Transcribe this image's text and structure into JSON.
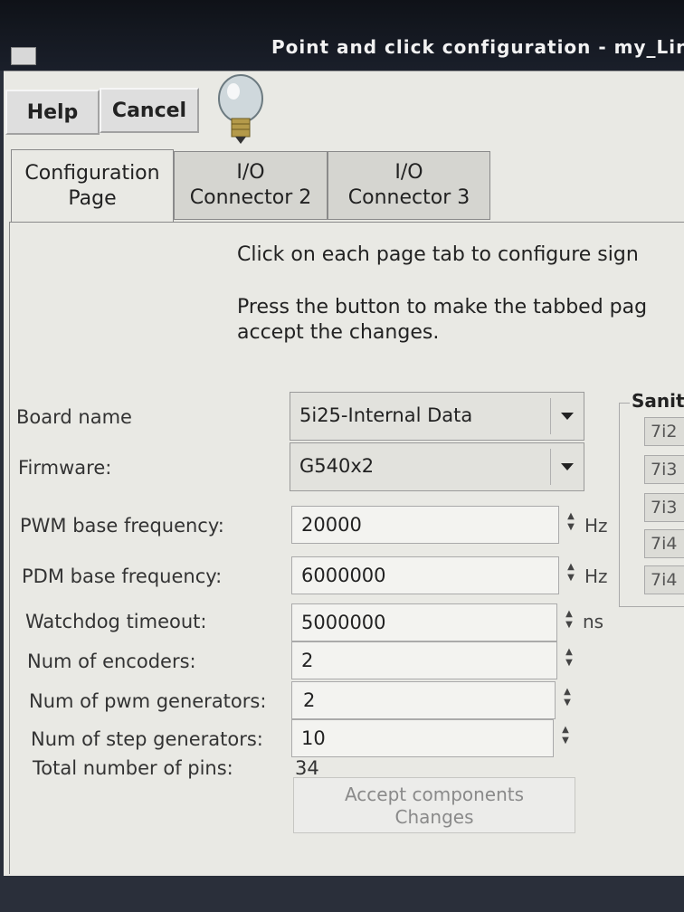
{
  "window": {
    "title": "Point and click configuration - my_Lin"
  },
  "toolbar": {
    "help_label": "Help",
    "cancel_label": "Cancel"
  },
  "tabs": [
    {
      "line1": "Configuration",
      "line2": "Page"
    },
    {
      "line1": "I/O",
      "line2": "Connector 2"
    },
    {
      "line1": "I/O",
      "line2": "Connector 3"
    }
  ],
  "instructions": {
    "line1": "Click on each page tab to configure sign",
    "line2": "Press the button to make the tabbed pag",
    "line3": "accept the changes."
  },
  "fields": {
    "board_name": {
      "label": "Board name",
      "value": "5i25-Internal Data"
    },
    "firmware": {
      "label": "Firmware:",
      "value": "G540x2"
    },
    "pwm_freq": {
      "label": "PWM base frequency:",
      "value": "20000",
      "unit": "Hz"
    },
    "pdm_freq": {
      "label": "PDM base frequency:",
      "value": "6000000",
      "unit": "Hz"
    },
    "watchdog": {
      "label": "Watchdog timeout:",
      "value": "5000000",
      "unit": "ns"
    },
    "encoders": {
      "label": "Num of encoders:",
      "value": "2"
    },
    "pwm_gen": {
      "label": "Num of pwm generators:",
      "value": "2"
    },
    "step_gen": {
      "label": "Num of step generators:",
      "value": "10"
    },
    "total_pins": {
      "label": "Total number of pins:",
      "value": "34"
    }
  },
  "accept": {
    "line1": "Accept  components",
    "line2": "Changes"
  },
  "sanity": {
    "title": "Sanit",
    "items": [
      "7i2",
      "7i3",
      "7i3",
      "7i4",
      "7i4"
    ]
  }
}
